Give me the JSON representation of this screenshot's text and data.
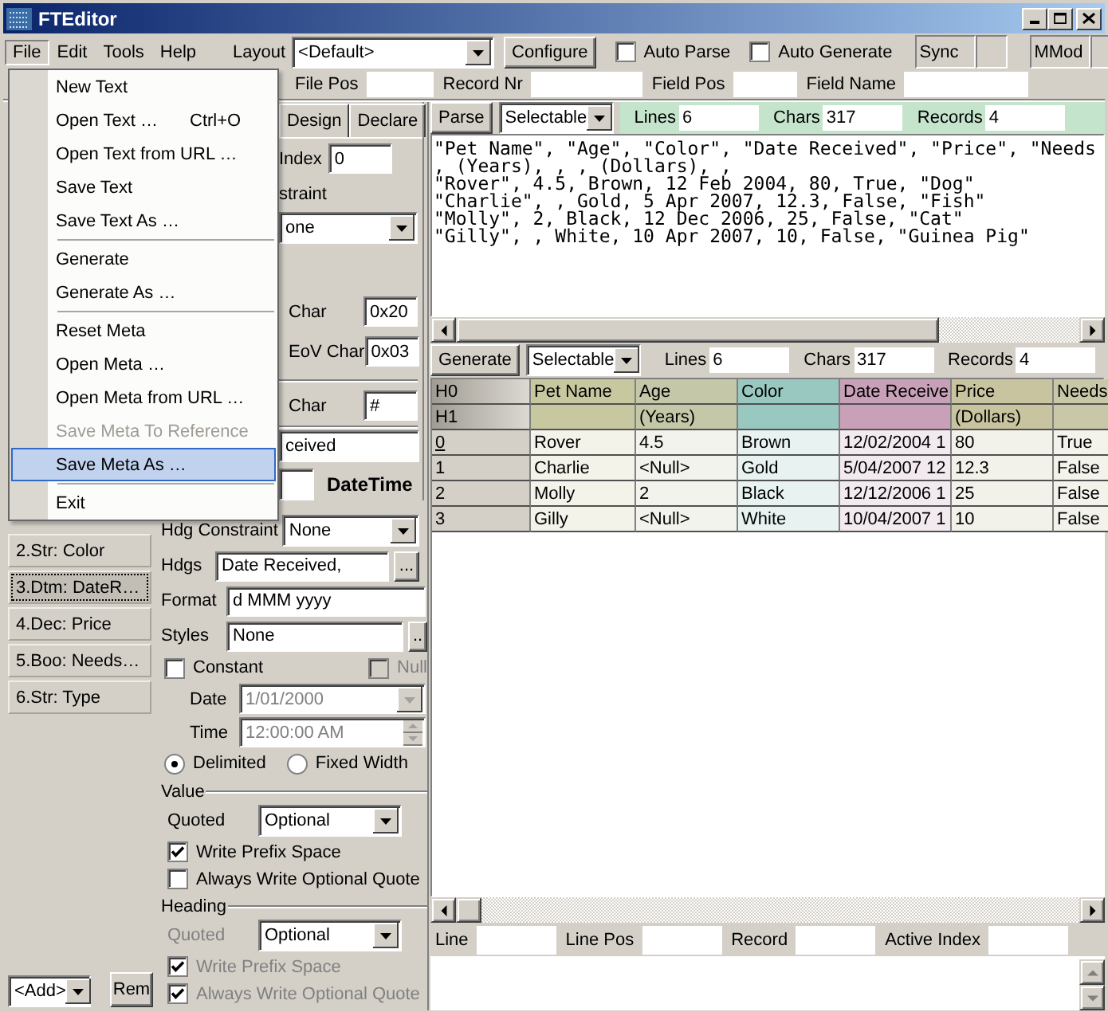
{
  "window": {
    "title": "FTEditor"
  },
  "menu_bar": [
    {
      "label": "File",
      "selected": true
    },
    {
      "label": "Edit",
      "selected": false
    },
    {
      "label": "Tools",
      "selected": false
    },
    {
      "label": "Help",
      "selected": false
    }
  ],
  "toolbar": {
    "layout_label": "Layout",
    "layout_value": "<Default>",
    "configure_button": "Configure",
    "checkboxes": [
      {
        "label": "Auto Parse",
        "checked": false
      },
      {
        "label": "Auto Generate",
        "checked": false
      }
    ],
    "indicators": [
      "Sync",
      "MMod"
    ]
  },
  "position_bar": [
    "File Pos",
    "Record Nr",
    "Field Pos",
    "Field Name"
  ],
  "field_list": {
    "items": [
      {
        "label": "2.Str: Color",
        "selected": false
      },
      {
        "label": "3.Dtm: DateR…",
        "selected": true
      },
      {
        "label": "4.Dec: Price",
        "selected": false
      },
      {
        "label": "5.Boo: Needs…",
        "selected": false
      },
      {
        "label": "6.Str: Type",
        "selected": false
      }
    ],
    "add_value": "<Add>",
    "remove_button": "Rem"
  },
  "field_editor": {
    "tabs": [
      {
        "label": "Design",
        "selected": false
      },
      {
        "label": "Declare",
        "selected": false
      }
    ],
    "index": {
      "label": "Index",
      "value": "0"
    },
    "constraint": {
      "label": "straint",
      "value": "one"
    },
    "char_fields": [
      {
        "label": "Char",
        "value": "0x20"
      },
      {
        "label": "EoV Char",
        "value": "0x03"
      }
    ],
    "escape_field": {
      "label": "Char",
      "value": "#"
    },
    "name_value": "ceived",
    "type_label": "DateTime",
    "hdg_constraint": {
      "label": "Hdg Constraint",
      "value": "None"
    },
    "hdgs": {
      "label": "Hdgs",
      "value": "Date Received,",
      "button": "..."
    },
    "format": {
      "label": "Format",
      "value": "d MMM yyyy"
    },
    "styles": {
      "label": "Styles",
      "value": "None",
      "button": ".."
    },
    "constant": {
      "label": "Constant",
      "checked": false
    },
    "null": {
      "label": "Null",
      "checked": false,
      "disabled": true
    },
    "date": {
      "label": "Date",
      "value": "1/01/2000",
      "disabled": true
    },
    "time": {
      "label": "Time",
      "value": "12:00:00 AM",
      "disabled": true
    },
    "layout_options": [
      {
        "label": "Delimited",
        "selected": true
      },
      {
        "label": "Fixed Width",
        "selected": false
      }
    ],
    "quote_groups": [
      {
        "title": "Value",
        "quoted_label": "Quoted",
        "quoted_value": "Optional",
        "disabled": false,
        "options": [
          {
            "label": "Write Prefix Space",
            "checked": true
          },
          {
            "label": "Always Write Optional Quote",
            "checked": false
          }
        ]
      },
      {
        "title": "Heading",
        "quoted_label": "Quoted",
        "quoted_value": "Optional",
        "disabled": true,
        "options": [
          {
            "label": "Write Prefix Space",
            "checked": true
          },
          {
            "label": "Always Write Optional Quote",
            "checked": true
          }
        ]
      }
    ]
  },
  "text_panel": {
    "parse_button": "Parse",
    "mode": "Selectable",
    "stats": [
      {
        "label": "Lines",
        "value": "6"
      },
      {
        "label": "Chars",
        "value": "317"
      },
      {
        "label": "Records",
        "value": "4"
      }
    ],
    "lines": [
      "\"Pet Name\", \"Age\", \"Color\", \"Date Received\", \"Price\", \"Needs",
      ", (Years), , , (Dollars), ,",
      "\"Rover\", 4.5, Brown, 12 Feb 2004, 80, True, \"Dog\"",
      "\"Charlie\", , Gold, 5 Apr 2007, 12.3, False, \"Fish\"",
      "\"Molly\", 2, Black, 12 Dec 2006, 25, False, \"Cat\"",
      "\"Gilly\", , White, 10 Apr 2007, 10, False, \"Guinea Pig\""
    ]
  },
  "grid_panel": {
    "generate_button": "Generate",
    "mode": "Selectable",
    "stats": [
      {
        "label": "Lines",
        "value": "6"
      },
      {
        "label": "Chars",
        "value": "317"
      },
      {
        "label": "Records",
        "value": "4"
      }
    ],
    "header_rows": [
      "H0",
      "H1"
    ],
    "columns": [
      {
        "heading": "Pet Name",
        "color": "#c8c8a0"
      },
      {
        "heading": "Age",
        "subheading": "(Years)",
        "color": "#c4c8a8"
      },
      {
        "heading": "Color",
        "color": "#98c8c0"
      },
      {
        "heading": "Date Receive",
        "color": "#c8a0b8"
      },
      {
        "heading": "Price",
        "subheading": "(Dollars)",
        "color": "#c8c4a0"
      },
      {
        "heading": "Needs",
        "color": "#c8c8a8"
      }
    ],
    "rows": [
      {
        "index": "0",
        "selected": true,
        "cells": [
          "Rover",
          "4.5",
          "Brown",
          "12/02/2004 1",
          "80",
          "True"
        ]
      },
      {
        "index": "1",
        "selected": false,
        "cells": [
          "Charlie",
          "<Null>",
          "Gold",
          "5/04/2007 12",
          "12.3",
          "False"
        ]
      },
      {
        "index": "2",
        "selected": false,
        "cells": [
          "Molly",
          "2",
          "Black",
          "12/12/2006 1",
          "25",
          "False"
        ]
      },
      {
        "index": "3",
        "selected": false,
        "cells": [
          "Gilly",
          "<Null>",
          "White",
          "10/04/2007 1",
          "10",
          "False"
        ]
      }
    ]
  },
  "status_bar": [
    "Line",
    "Line Pos",
    "Record",
    "Active Index"
  ],
  "file_menu": {
    "groups": [
      {
        "items": [
          {
            "label": "New Text",
            "selected": false,
            "disabled": false
          },
          {
            "label": "Open Text …",
            "shortcut": "Ctrl+O",
            "selected": false,
            "disabled": false
          },
          {
            "label": "Open Text from URL …",
            "selected": false,
            "disabled": false
          },
          {
            "label": "Save Text",
            "selected": false,
            "disabled": false
          },
          {
            "label": "Save Text As …",
            "selected": false,
            "disabled": false
          }
        ]
      },
      {
        "items": [
          {
            "label": "Generate",
            "selected": false,
            "disabled": false
          },
          {
            "label": "Generate As …",
            "selected": false,
            "disabled": false
          }
        ]
      },
      {
        "items": [
          {
            "label": "Reset Meta",
            "selected": false,
            "disabled": false
          },
          {
            "label": "Open Meta …",
            "selected": false,
            "disabled": false
          },
          {
            "label": "Open Meta from URL …",
            "selected": false,
            "disabled": false
          },
          {
            "label": "Save Meta To Reference",
            "selected": false,
            "disabled": true
          },
          {
            "label": "Save Meta As …",
            "selected": true,
            "disabled": false
          }
        ]
      },
      {
        "items": [
          {
            "label": "Exit",
            "selected": false,
            "disabled": false
          }
        ]
      }
    ]
  }
}
